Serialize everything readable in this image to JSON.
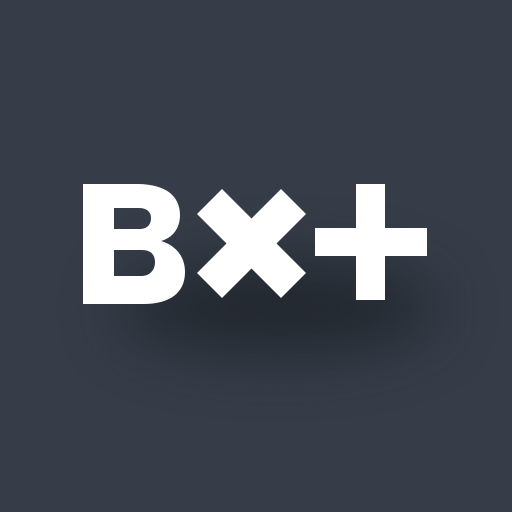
{
  "app_icon": {
    "brand_text": "Bx+"
  },
  "colors": {
    "background": "#363d48",
    "logo": "#ffffff",
    "shadow": "#12161c"
  },
  "icons": {
    "logo": "bx-plus-logo-icon"
  }
}
